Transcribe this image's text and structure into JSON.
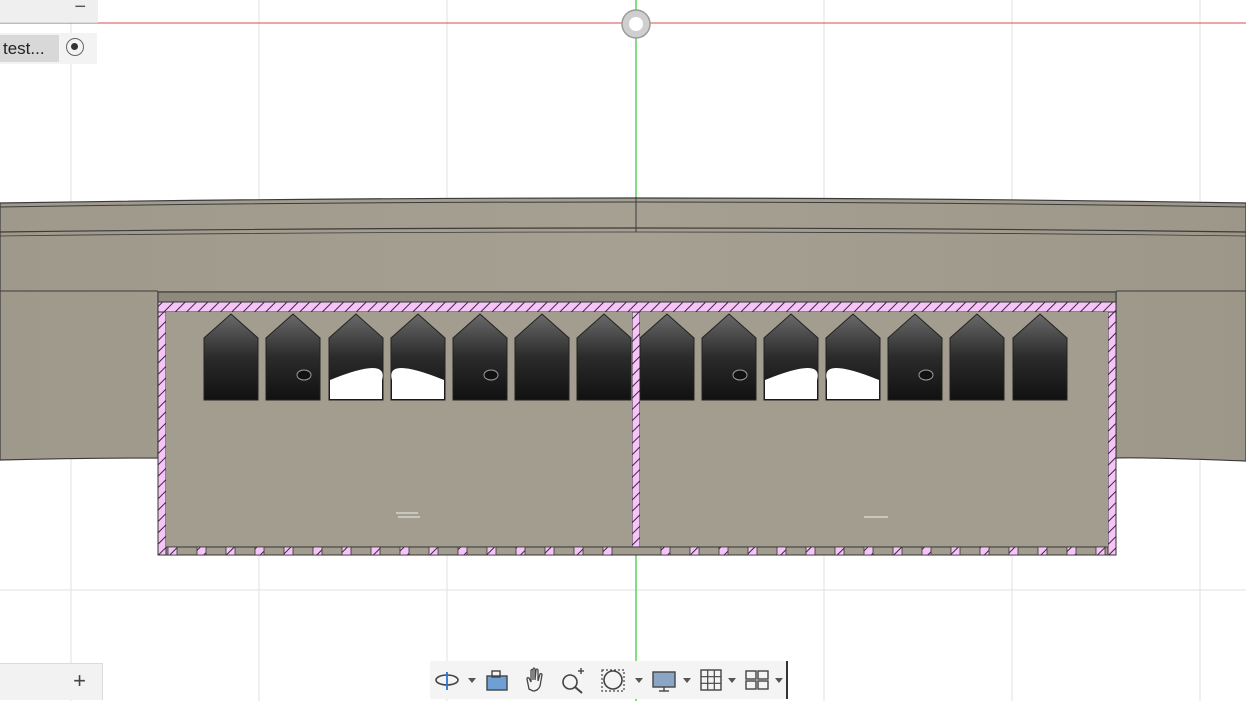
{
  "browser": {
    "collapse_symbol": "−",
    "component_name": "test...",
    "add_symbol": "+"
  },
  "viewport": {
    "icons": [
      "origin-point-icon"
    ],
    "colors": {
      "background": "#ffffff",
      "grid": "#e2e2e2",
      "x_axis": "#e04a4a",
      "y_axis": "#5ad35a",
      "body": "#a39d8f",
      "section_hatch": "#f1a8f5",
      "window": "#222222"
    }
  },
  "toolbar": {
    "items": [
      {
        "name": "orbit-icon",
        "dropdown": true
      },
      {
        "name": "look-at-icon",
        "dropdown": false
      },
      {
        "name": "pan-hand-icon",
        "dropdown": false
      },
      {
        "name": "zoom-icon",
        "dropdown": false
      },
      {
        "name": "fit-window-icon",
        "dropdown": true
      },
      {
        "name": "display-settings-icon",
        "dropdown": true
      },
      {
        "name": "grid-snap-icon",
        "dropdown": true
      },
      {
        "name": "viewports-icon",
        "dropdown": true
      }
    ]
  }
}
